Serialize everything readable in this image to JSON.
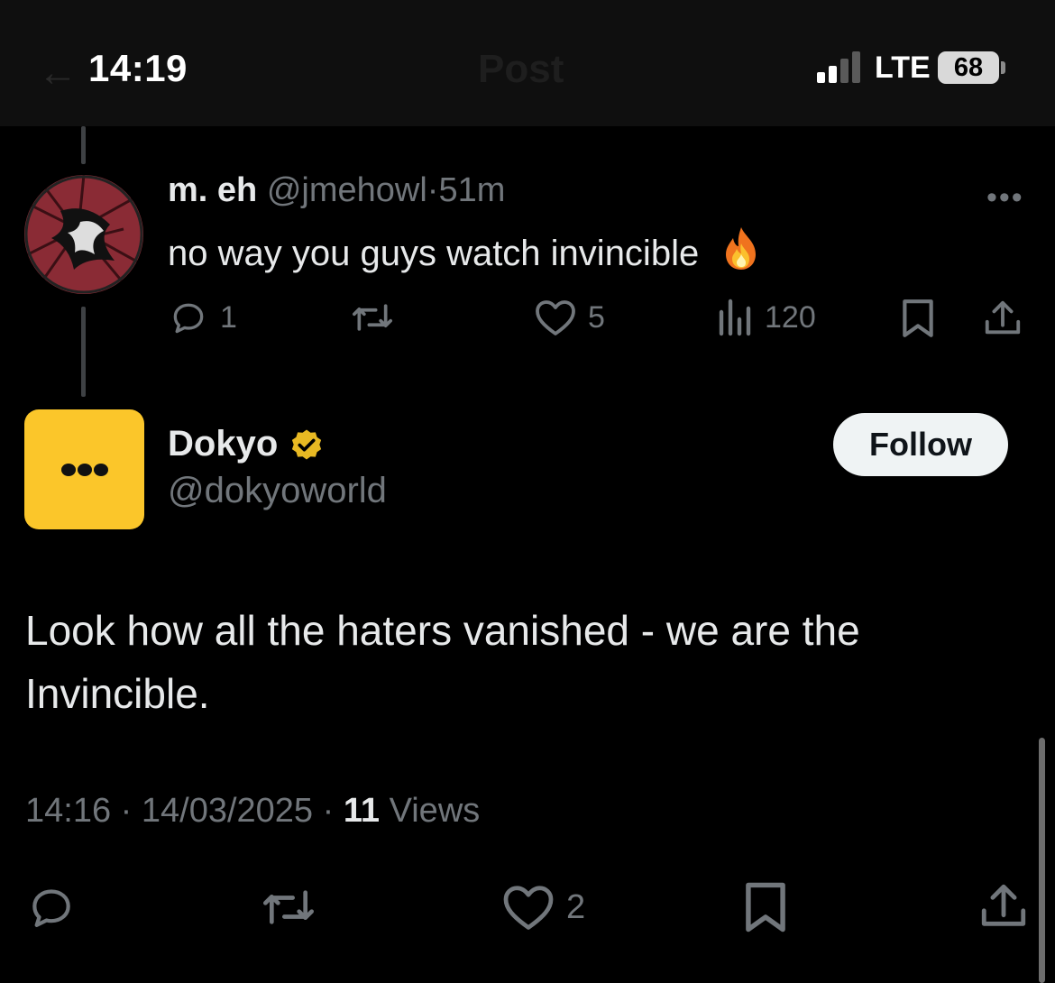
{
  "status_bar": {
    "time": "14:19",
    "network": "LTE",
    "battery": "68"
  },
  "header": {
    "back_icon": "arrow-left-icon",
    "title": "Post"
  },
  "reply": {
    "display_name": "m. eh",
    "handle": "@jmehowl",
    "separator": "·",
    "time_ago": "51m",
    "text": "no way you guys watch invincible",
    "emoji": "fire-icon",
    "actions": {
      "reply_count": "1",
      "retweet_count": "",
      "like_count": "5",
      "views_count": "120"
    }
  },
  "main_post": {
    "display_name": "Dokyo",
    "verified_icon": "verified-badge-icon",
    "verified_color": "#e8b923",
    "handle": "@dokyoworld",
    "follow_label": "Follow",
    "text": "Look how all the haters vanished - we are the Invincible.",
    "time": "14:16",
    "date": "14/03/2025",
    "meta_separator": "·",
    "views_count": "11",
    "views_label": "Views",
    "actions": {
      "like_count": "2"
    }
  },
  "colors": {
    "background": "#000000",
    "text": "#e7e9ea",
    "muted": "#71767b",
    "avatar_yellow": "#fbc62a",
    "follow_bg": "#eff3f4"
  }
}
